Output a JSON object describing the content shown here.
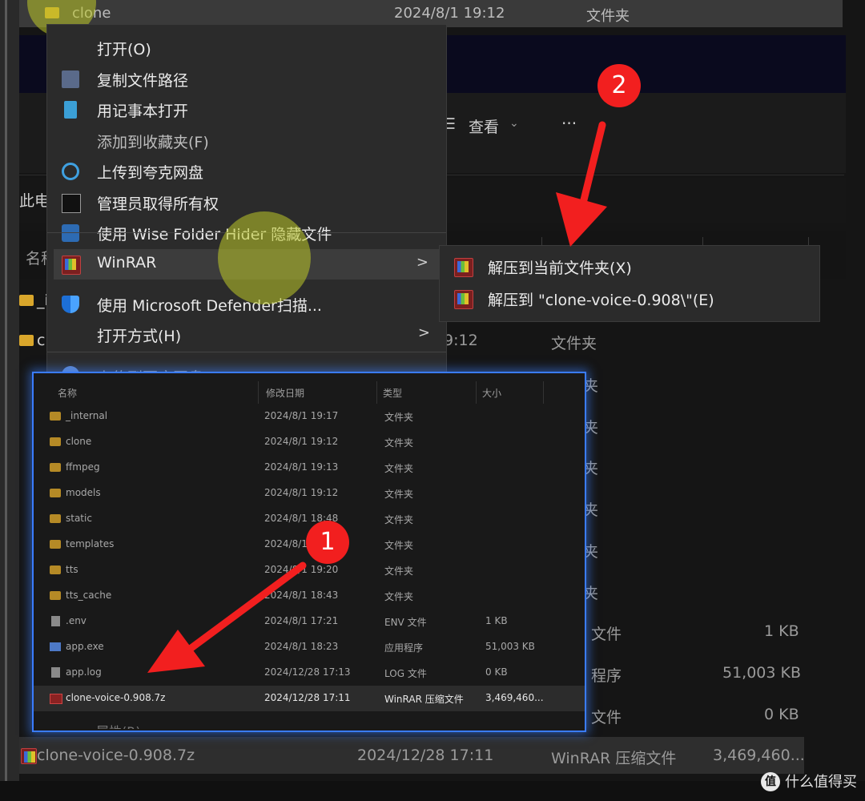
{
  "explorer": {
    "top_row": {
      "name": "clone",
      "date": "2024/8/1 19:12",
      "type": "文件夹"
    },
    "toolbar": {
      "view_label": "查看",
      "more_label": "···"
    },
    "address_fragment": "此电",
    "column_fragment": "名称",
    "bg_rows": [
      {
        "left": "_i",
        "right": ""
      },
      {
        "left": "cl",
        "mid": "9:12",
        "right": "文件夹"
      },
      {
        "right": "夹"
      },
      {
        "right": "夹"
      },
      {
        "right": "夹"
      },
      {
        "right": "夹"
      },
      {
        "right": "夹"
      },
      {
        "right": "夹"
      },
      {
        "right": "文件",
        "size": "1 KB"
      },
      {
        "right": "程序",
        "size": "51,003 KB"
      },
      {
        "right": "文件",
        "size": "0 KB"
      }
    ],
    "bottom_row": {
      "name": "clone-voice-0.908.7z",
      "date": "2024/12/28 17:11",
      "type": "WinRAR 压缩文件",
      "size": "3,469,460..."
    },
    "partial_text": {
      "baidu": "上传到百度网盘",
      "properties": "属性(R)"
    }
  },
  "context_menu": {
    "items": [
      {
        "label": "打开(O)",
        "icon": "none"
      },
      {
        "label": "复制文件路径",
        "icon": "path-icon"
      },
      {
        "label": "用记事本打开",
        "icon": "notepad-icon"
      },
      {
        "label": "添加到收藏夹(F)",
        "icon": "none"
      },
      {
        "label": "上传到夸克网盘",
        "icon": "cloud-icon"
      },
      {
        "label": "管理员取得所有权",
        "icon": "cmd-icon"
      },
      {
        "label": "使用 Wise Folder Hider 隐藏文件",
        "icon": "lock-icon"
      },
      {
        "label": "WinRAR",
        "icon": "winrar-icon",
        "arrow": ">"
      },
      {
        "label": "使用 Microsoft Defender扫描...",
        "icon": "shield-icon"
      },
      {
        "label": "打开方式(H)",
        "icon": "none",
        "arrow": ">"
      }
    ]
  },
  "submenu": {
    "items": [
      {
        "label": "解压到当前文件夹(X)",
        "icon": "winrar-icon"
      },
      {
        "label": "解压到 \"clone-voice-0.908\\\"(E)",
        "icon": "winrar-icon"
      }
    ]
  },
  "inset": {
    "headers": [
      "名称",
      "修改日期",
      "类型",
      "大小"
    ],
    "rows": [
      {
        "name": "_internal",
        "date": "2024/8/1 19:17",
        "type": "文件夹",
        "size": "",
        "kind": "folder"
      },
      {
        "name": "clone",
        "date": "2024/8/1 19:12",
        "type": "文件夹",
        "size": "",
        "kind": "folder"
      },
      {
        "name": "ffmpeg",
        "date": "2024/8/1 19:13",
        "type": "文件夹",
        "size": "",
        "kind": "folder"
      },
      {
        "name": "models",
        "date": "2024/8/1 19:12",
        "type": "文件夹",
        "size": "",
        "kind": "folder"
      },
      {
        "name": "static",
        "date": "2024/8/1 18:48",
        "type": "文件夹",
        "size": "",
        "kind": "folder"
      },
      {
        "name": "templates",
        "date": "2024/8/1",
        "type": "文件夹",
        "size": "",
        "kind": "folder"
      },
      {
        "name": "tts",
        "date": "2024/8/1 19:20",
        "type": "文件夹",
        "size": "",
        "kind": "folder"
      },
      {
        "name": "tts_cache",
        "date": "2024/8/1 18:43",
        "type": "文件夹",
        "size": "",
        "kind": "folder"
      },
      {
        "name": ".env",
        "date": "2024/8/1 17:21",
        "type": "ENV 文件",
        "size": "1 KB",
        "kind": "file"
      },
      {
        "name": "app.exe",
        "date": "2024/8/1 18:23",
        "type": "应用程序",
        "size": "51,003 KB",
        "kind": "exe"
      },
      {
        "name": "app.log",
        "date": "2024/12/28 17:13",
        "type": "LOG 文件",
        "size": "0 KB",
        "kind": "file"
      },
      {
        "name": "clone-voice-0.908.7z",
        "date": "2024/12/28 17:11",
        "type": "WinRAR 压缩文件",
        "size": "3,469,460...",
        "kind": "rar"
      }
    ]
  },
  "badges": {
    "one": "1",
    "two": "2"
  },
  "watermark": {
    "logo": "值",
    "text": "什么值得买"
  },
  "colors": {
    "annotation_red": "#f21f1f",
    "inset_border": "#3a7cff",
    "menu_bg": "#2b2b2b"
  }
}
